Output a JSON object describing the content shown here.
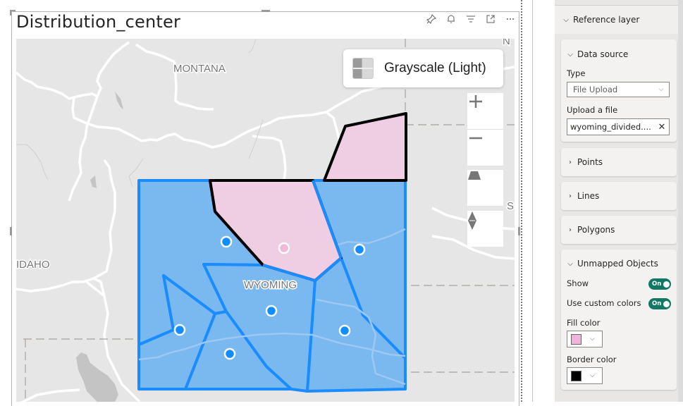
{
  "visual": {
    "title": "Distribution_center",
    "header_icons": [
      {
        "name": "pin-icon",
        "glyph": "⌖"
      },
      {
        "name": "bell-icon",
        "glyph": "⍾"
      },
      {
        "name": "filter-icon",
        "glyph": "☰"
      },
      {
        "name": "focus-mode-icon",
        "glyph": "⤢"
      },
      {
        "name": "more-options-icon",
        "glyph": "⋯"
      }
    ]
  },
  "map": {
    "basemap_label": "Grayscale (Light)",
    "labels": {
      "montana": "MONTANA",
      "idaho": "IDAHO",
      "wyoming": "WYOMING",
      "edge_north": "N",
      "edge_south": "S"
    },
    "controls": {
      "zoom_in": "+",
      "zoom_out": "−",
      "tilt": "tilt",
      "compass": "compass"
    },
    "colors": {
      "region_fill": "#7ab8f0",
      "region_border": "#1a8cff",
      "highlight_fill": "#efcde3",
      "highlight_border": "#000000",
      "point_fill": "#118dff",
      "highlight_point_fill": "#f0b8da"
    }
  },
  "format_pane": {
    "reference_layer": "Reference layer",
    "data_source": {
      "header": "Data source",
      "type_label": "Type",
      "type_value": "File Upload",
      "upload_label": "Upload a file",
      "upload_value": "wyoming_divided...."
    },
    "sections": {
      "points": "Points",
      "lines": "Lines",
      "polygons": "Polygons"
    },
    "unmapped": {
      "header": "Unmapped Objects",
      "show_label": "Show",
      "show_state": "On",
      "custom_colors_label": "Use custom colors",
      "custom_colors_state": "On",
      "fill_label": "Fill color",
      "fill_color": "#f0b4dc",
      "border_label": "Border color",
      "border_color": "#000000"
    }
  }
}
